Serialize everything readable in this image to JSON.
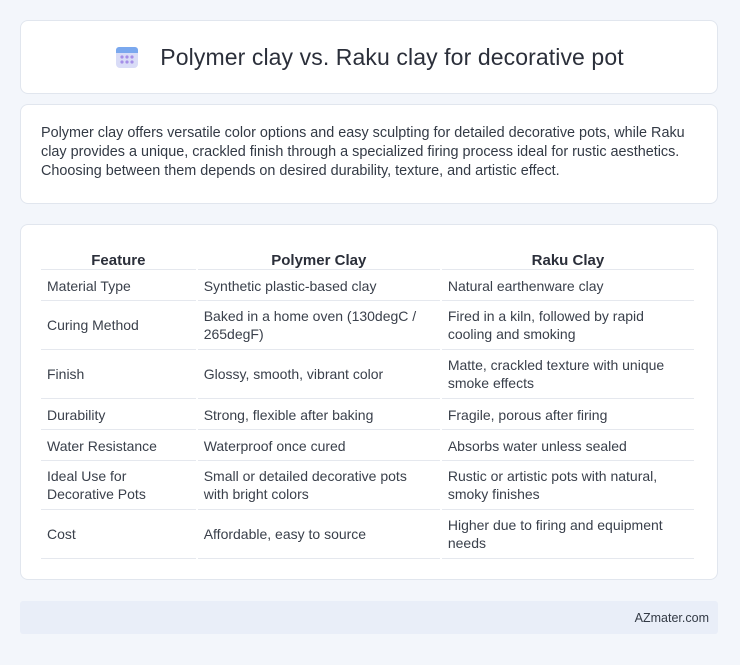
{
  "header": {
    "title": "Polymer clay vs. Raku clay for decorative pot",
    "icon": "calendar-icon"
  },
  "summary": {
    "text": "Polymer clay offers versatile color options and easy sculpting for detailed decorative pots, while Raku clay provides a unique, crackled finish through a specialized firing process ideal for rustic aesthetics. Choosing between them depends on desired durability, texture, and artistic effect."
  },
  "table": {
    "headers": [
      "Feature",
      "Polymer Clay",
      "Raku Clay"
    ],
    "rows": [
      [
        "Material Type",
        "Synthetic plastic-based clay",
        "Natural earthenware clay"
      ],
      [
        "Curing Method",
        "Baked in a home oven (130degC / 265degF)",
        "Fired in a kiln, followed by rapid cooling and smoking"
      ],
      [
        "Finish",
        "Glossy, smooth, vibrant color",
        "Matte, crackled texture with unique smoke effects"
      ],
      [
        "Durability",
        "Strong, flexible after baking",
        "Fragile, porous after firing"
      ],
      [
        "Water Resistance",
        "Waterproof once cured",
        "Absorbs water unless sealed"
      ],
      [
        "Ideal Use for Decorative Pots",
        "Small or detailed decorative pots with bright colors",
        "Rustic or artistic pots with natural, smoky finishes"
      ],
      [
        "Cost",
        "Affordable, easy to source",
        "Higher due to firing and equipment needs"
      ]
    ]
  },
  "footer": {
    "brand": "AZmater.com"
  },
  "colors": {
    "background": "#f3f6fb",
    "card": "#ffffff",
    "footer": "#e9eef8",
    "icon_accent": "#8f7fe0"
  }
}
